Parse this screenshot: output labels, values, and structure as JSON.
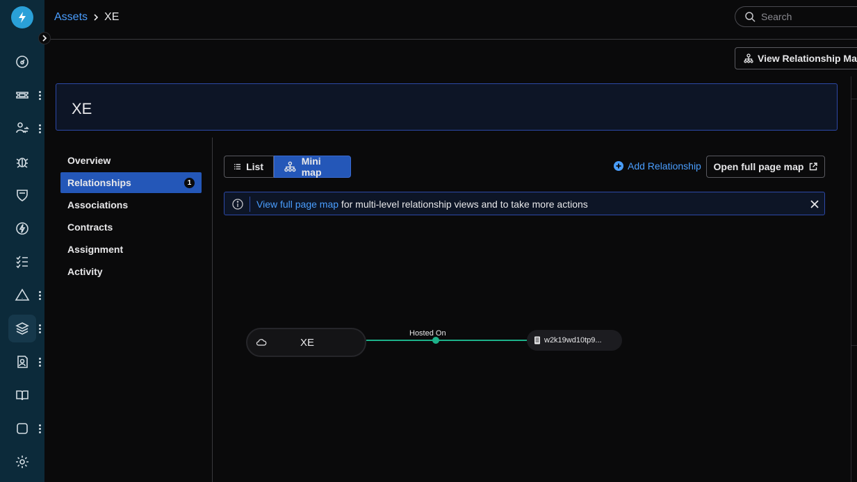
{
  "rail": {
    "logo": "bolt-logo",
    "icons": [
      "dashboard-icon",
      "tickets-icon",
      "changes-icon",
      "bug-icon",
      "shield-icon",
      "flash-icon",
      "checklist-icon",
      "alert-icon",
      "layers-icon",
      "people-icon",
      "book-icon",
      "square-icon",
      "gear-icon"
    ]
  },
  "breadcrumb": {
    "parent": "Assets",
    "current": "XE"
  },
  "search": {
    "placeholder": "Search"
  },
  "header_actions": {
    "view_relationship_map": "View Relationship Map"
  },
  "asset": {
    "title": "XE"
  },
  "side_nav": {
    "items": [
      {
        "label": "Overview"
      },
      {
        "label": "Relationships",
        "badge": "1",
        "active": true
      },
      {
        "label": "Associations"
      },
      {
        "label": "Contracts"
      },
      {
        "label": "Assignment"
      },
      {
        "label": "Activity"
      }
    ]
  },
  "view_toggle": {
    "list": "List",
    "mini_map": "Mini map",
    "selected": "mini_map"
  },
  "actions": {
    "add_relationship": "Add Relationship",
    "open_full_page_map": "Open full page map"
  },
  "banner": {
    "link": "View full page map",
    "text": " for multi-level relationship views and to take more actions"
  },
  "map": {
    "source_node": "XE",
    "edge_label": "Hosted On",
    "target_node": "w2k19wd10tp9..."
  },
  "colors": {
    "accent": "#2457b8",
    "link": "#4a9eff",
    "edge": "#1db28a",
    "rail": "#0c2a3a"
  }
}
